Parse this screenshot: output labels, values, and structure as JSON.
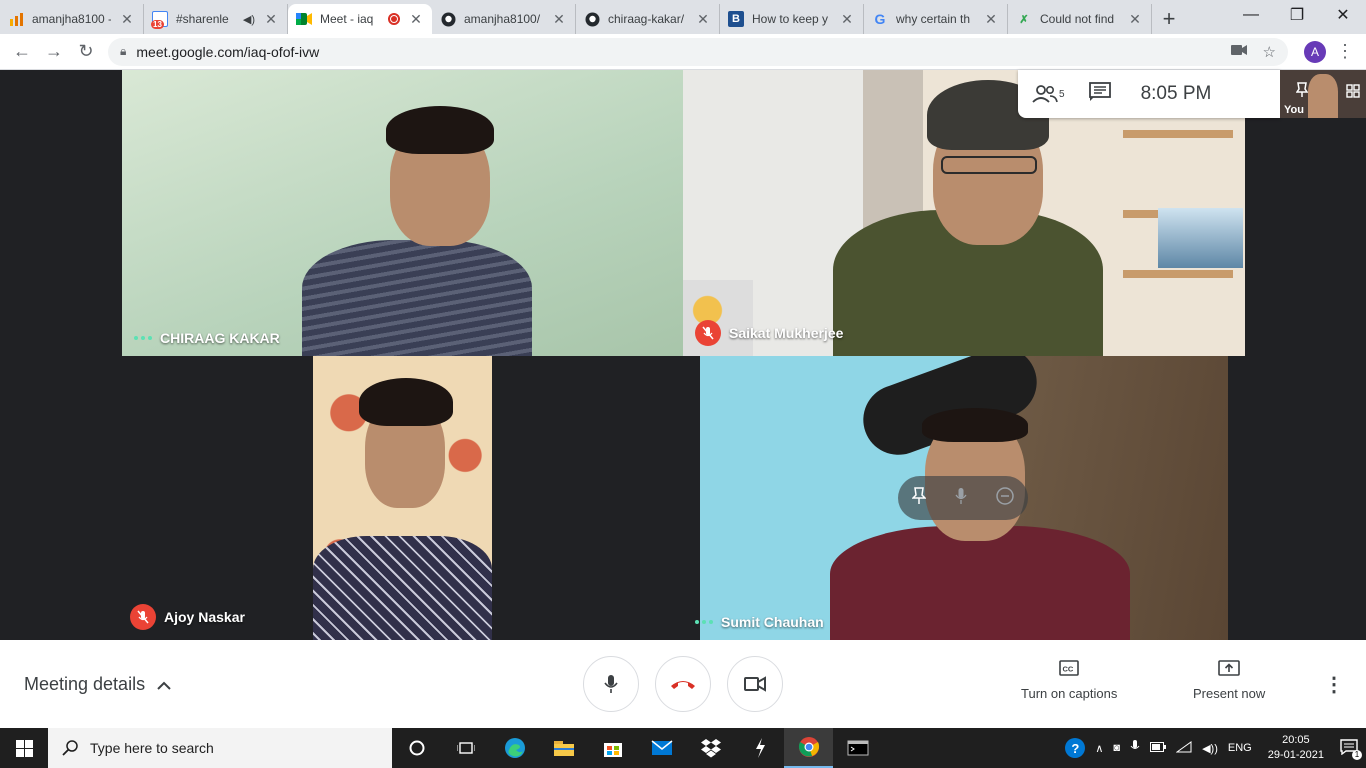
{
  "browser": {
    "tabs": [
      {
        "label": "amanjha8100 -",
        "icon": "analytics-icon",
        "active": false
      },
      {
        "label": "#sharenle",
        "icon": "calendar-badge-icon",
        "badge": "13",
        "active": false
      },
      {
        "label": "Meet - iaq",
        "icon": "meet-icon",
        "active": true
      },
      {
        "label": "amanjha8100/",
        "icon": "github-icon",
        "active": false
      },
      {
        "label": "chiraag-kakar/",
        "icon": "github-icon",
        "active": false
      },
      {
        "label": "How to keep y",
        "icon": "b-icon",
        "active": false
      },
      {
        "label": "why certain th",
        "icon": "google-icon",
        "active": false
      },
      {
        "label": "Could not find",
        "icon": "site-icon",
        "active": false
      }
    ],
    "url": "meet.google.com/iaq-ofof-ivw",
    "profile_initial": "A"
  },
  "meet": {
    "participant_count": "5",
    "clock": "8:05 PM",
    "self_label": "You",
    "participants": [
      {
        "name": "CHIRAAG KAKAR",
        "muted": false
      },
      {
        "name": "Saikat Mukherjee",
        "muted": true
      },
      {
        "name": "Ajoy Naskar",
        "muted": true
      },
      {
        "name": "Sumit Chauhan",
        "muted": false
      }
    ]
  },
  "bottom": {
    "meeting_details": "Meeting details",
    "captions": "Turn on captions",
    "present": "Present now"
  },
  "taskbar": {
    "search_placeholder": "Type here to search",
    "lang": "ENG",
    "time": "20:05",
    "date": "29-01-2021",
    "notifications": "1"
  },
  "colors": {
    "accent_red": "#ea4335",
    "speaking_green": "#5ce1b4",
    "meet_bg": "#202124"
  }
}
